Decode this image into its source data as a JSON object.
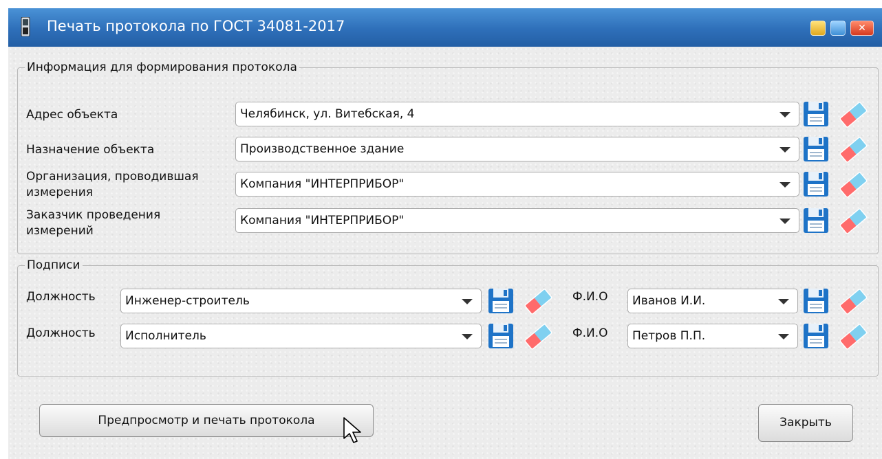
{
  "window": {
    "title": "Печать протокола по ГОСТ 34081-2017",
    "close_glyph": "✕"
  },
  "info_group": {
    "legend": "Информация для формирования протокола",
    "rows": [
      {
        "label": "Адрес объекта",
        "value": "Челябинск, ул. Витебская, 4"
      },
      {
        "label": "Назначение объекта",
        "value": "Производственное здание"
      },
      {
        "label": "Организация, проводившая измерения",
        "value": "Компания \"ИНТЕРПРИБОР\""
      },
      {
        "label": "Заказчик проведения измерений",
        "value": "Компания \"ИНТЕРПРИБОР\""
      }
    ]
  },
  "sign_group": {
    "legend": "Подписи",
    "rows": [
      {
        "position_label": "Должность",
        "position_value": "Инженер-строитель",
        "name_label": "Ф.И.О",
        "name_value": "Иванов И.И."
      },
      {
        "position_label": "Должность",
        "position_value": "Исполнитель",
        "name_label": "Ф.И.О",
        "name_value": "Петров П.П."
      }
    ]
  },
  "buttons": {
    "preview": "Предпросмотр и печать протокола",
    "close": "Закрыть"
  },
  "icons": {
    "save": "floppy-disk-icon",
    "clear": "eraser-icon",
    "app": "device-icon"
  },
  "colors": {
    "titlebar": "#2e6fb9",
    "floppy": "#1e73c7",
    "eraser_red": "#ff6b6b",
    "eraser_blue": "#7fd0f0"
  }
}
